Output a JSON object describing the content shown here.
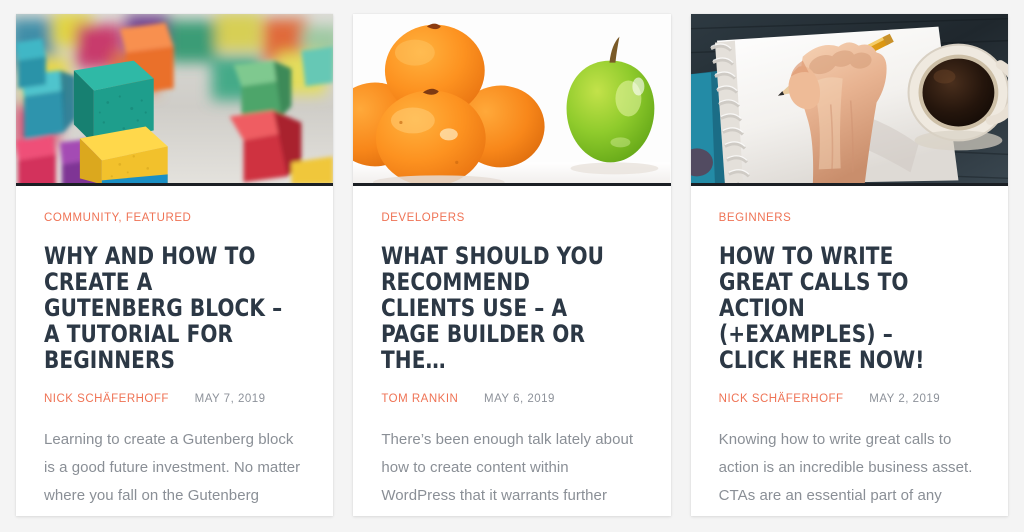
{
  "page": {
    "background_color": "#f4f4f4",
    "layout": "three-column-post-grid"
  },
  "theme": {
    "accent_color": "#ef7355",
    "title_color": "#2c3845",
    "body_text_color": "#8a8f96",
    "date_color": "#8d929a",
    "card_background": "#ffffff",
    "thumb_border_color": "#1b1f24"
  },
  "cards": [
    {
      "thumbnail_name": "colorful-wooden-toy-blocks-photo",
      "thumbnail_alt": "Stacks of brightly colored wooden toy blocks on a textured grey surface",
      "categories": "COMMUNITY, FEATURED",
      "title": "WHY AND HOW TO CREATE A GUTENBERG BLOCK – A TUTORIAL FOR BEGINNERS",
      "author": "NICK SCHÄFERHOFF",
      "date": "MAY 7, 2019",
      "excerpt": "Learning to create a Gutenberg block is a good future investment. No matter where you fall on the Gutenberg debate, the block…"
    },
    {
      "thumbnail_name": "oranges-and-green-apple-photo",
      "thumbnail_alt": "A pile of oranges next to a single green apple on a white background",
      "categories": "DEVELOPERS",
      "title": "WHAT SHOULD YOU RECOMMEND CLIENTS USE – A PAGE BUILDER OR THE…",
      "author": "TOM RANKIN",
      "date": "MAY 6, 2019",
      "excerpt": "There’s been enough talk lately about how to create content within WordPress that it warrants further attention. While there…"
    },
    {
      "thumbnail_name": "hand-writing-notebook-coffee-photo",
      "thumbnail_alt": "A hand holding a yellow pencil writing in a spiral notebook beside a cup of black coffee",
      "categories": "BEGINNERS",
      "title": "HOW TO WRITE GREAT CALLS TO ACTION (+EXAMPLES) – CLICK HERE NOW!",
      "author": "NICK SCHÄFERHOFF",
      "date": "MAY 2, 2019",
      "excerpt": "Knowing how to write great calls to action is an incredible business asset. CTAs are an essential part of any landing page, newsletter…"
    }
  ]
}
